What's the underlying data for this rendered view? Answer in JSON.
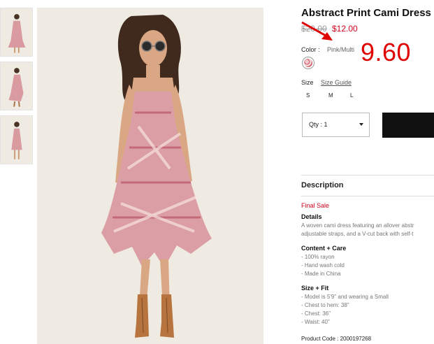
{
  "product": {
    "title": "Abstract Print Cami Dress",
    "old_price": "$20.00",
    "sale_price": "$12.00",
    "annotated_price": "9.60",
    "color_label": "Color :",
    "color_value": "Pink/Multi",
    "size_label": "Size",
    "size_guide": "Size Guide",
    "sizes": [
      "S",
      "M",
      "L"
    ],
    "qty_label": "Qty : 1",
    "accent_color": "#d0021b"
  },
  "description": {
    "heading": "Description",
    "final_sale": "Final Sale",
    "details_heading": "Details",
    "details_lines": [
      "A woven cami dress featuring an allover abstr",
      "adjustable straps, and a V-cut back with self-t"
    ],
    "care_heading": "Content + Care",
    "care_lines": [
      "- 100% rayon",
      "- Hand wash cold",
      "- Made in China"
    ],
    "fit_heading": "Size + Fit",
    "fit_lines": [
      "- Model is 5'9\" and wearing a Small",
      "- Chest to hem: 38\"",
      "- Chest: 36\"",
      "- Waist: 40\""
    ],
    "product_code": "Product Code : 2000197268"
  }
}
